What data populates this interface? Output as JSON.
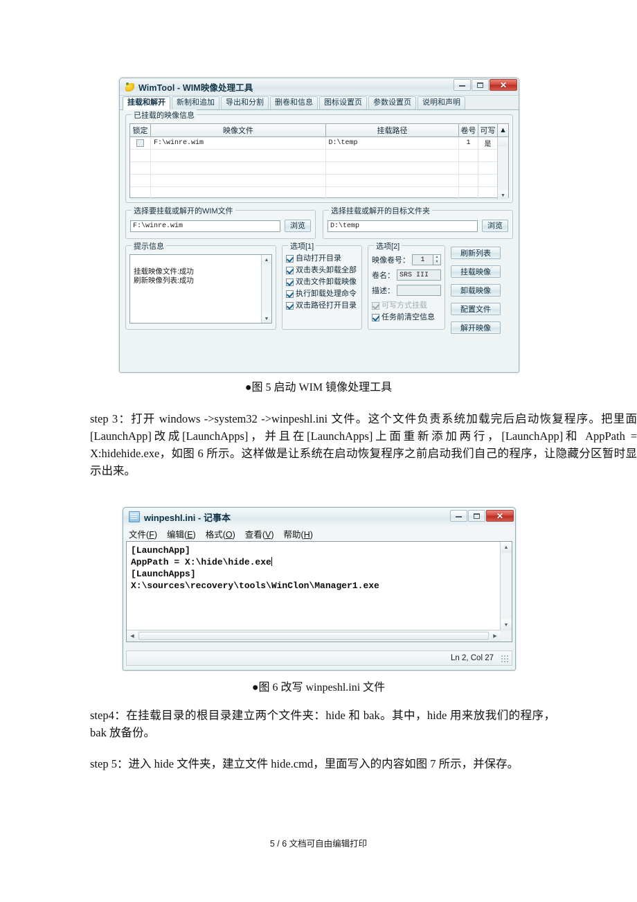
{
  "document": {
    "footer": "5 / 6 文档可自由编辑打印",
    "figure5_caption": "●图 5  启动 WIM 镜像处理工具",
    "figure6_caption": "●图 6  改写 winpeshl.ini 文件",
    "step3": "step 3：打开 windows ->system32 ->winpeshl.ini 文件。这个文件负责系统加载完后启动恢复程序。把里面[LaunchApp]改成[LaunchApps]，并且在[LaunchApps]上面重新添加两行，[LaunchApp]和 AppPath = X:hidehide.exe，如图 6 所示。这样做是让系统在启动恢复程序之前启动我们自己的程序，让隐藏分区暂时显示出来。",
    "step4": "step4：在挂载目录的根目录建立两个文件夹：hide 和 bak。其中，hide 用来放我们的程序，bak 放备份。",
    "step5": "step 5：进入 hide 文件夹，建立文件 hide.cmd，里面写入的内容如图 7 所示，并保存。"
  },
  "wimtool": {
    "title": "WimTool - WIM映像处理工具",
    "app_icon": "wimtool-icon",
    "caption_buttons": {
      "minimize": "minimize-icon",
      "maximize": "maximize-icon",
      "close": "✕"
    },
    "tabs": [
      {
        "label": "挂载和解开",
        "active": true
      },
      {
        "label": "新制和追加",
        "active": false
      },
      {
        "label": "导出和分割",
        "active": false
      },
      {
        "label": "删卷和信息",
        "active": false
      },
      {
        "label": "图标设置页",
        "active": false
      },
      {
        "label": "参数设置页",
        "active": false
      },
      {
        "label": "说明和声明",
        "active": false
      }
    ],
    "mounted_group": {
      "title": "已挂载的映像信息",
      "columns": [
        "锁定",
        "映像文件",
        "挂载路径",
        "卷号",
        "可写"
      ],
      "rows": [
        {
          "lock": "",
          "file": "F:\\winre.wim",
          "path": "D:\\temp",
          "volume": "1",
          "writable": "是"
        }
      ],
      "empty_rows": 4
    },
    "source_group": {
      "title": "选择要挂载或解开的WIM文件",
      "value": "F:\\winre.wim",
      "browse_label": "浏览"
    },
    "target_group": {
      "title": "选择挂载或解开的目标文件夹",
      "value": "D:\\temp",
      "browse_label": "浏览"
    },
    "log_group": {
      "title": "提示信息",
      "lines": [
        "挂载映像文件:成功",
        "刷新映像列表:成功"
      ]
    },
    "options1": {
      "title": "选项[1]",
      "items": [
        {
          "label": "自动打开目录",
          "checked": true,
          "disabled": false
        },
        {
          "label": "双击表头卸载全部",
          "checked": true,
          "disabled": false
        },
        {
          "label": "双击文件卸载映像",
          "checked": true,
          "disabled": false
        },
        {
          "label": "执行卸载处理命令",
          "checked": true,
          "disabled": false
        },
        {
          "label": "双击路径打开目录",
          "checked": true,
          "disabled": false
        }
      ]
    },
    "options2": {
      "title": "选项[2]",
      "volume_label": "映像卷号：",
      "volume_value": "1",
      "name_label": "卷名：",
      "name_value": "SRS III",
      "desc_label": "描述：",
      "desc_value": "",
      "checkboxes": [
        {
          "label": "可写方式挂载",
          "checked": true,
          "disabled": true
        },
        {
          "label": "任务前清空信息",
          "checked": true,
          "disabled": false
        }
      ]
    },
    "action_buttons": [
      "刷新列表",
      "挂载映像",
      "卸载映像",
      "配置文件",
      "解开映像"
    ]
  },
  "notepad": {
    "title": "winpeshl.ini - 记事本",
    "icon": "notepad-icon",
    "caption_buttons": {
      "minimize": "minimize-icon",
      "maximize": "maximize-icon",
      "close": "✕"
    },
    "menus": [
      {
        "text": "文件",
        "accel": "F"
      },
      {
        "text": "编辑",
        "accel": "E"
      },
      {
        "text": "格式",
        "accel": "O"
      },
      {
        "text": "查看",
        "accel": "V"
      },
      {
        "text": "帮助",
        "accel": "H"
      }
    ],
    "content_lines": [
      "[LaunchApp]",
      "AppPath = X:\\hide\\hide.exe",
      "[LaunchApps]",
      "X:\\sources\\recovery\\tools\\WinClon\\Manager1.exe"
    ],
    "status": "Ln 2, Col 27"
  },
  "colors": {
    "window_chrome": "#eef3f4",
    "accent_border": "#9fb6bd",
    "close_red": "#c3392c",
    "text": "#111111"
  }
}
